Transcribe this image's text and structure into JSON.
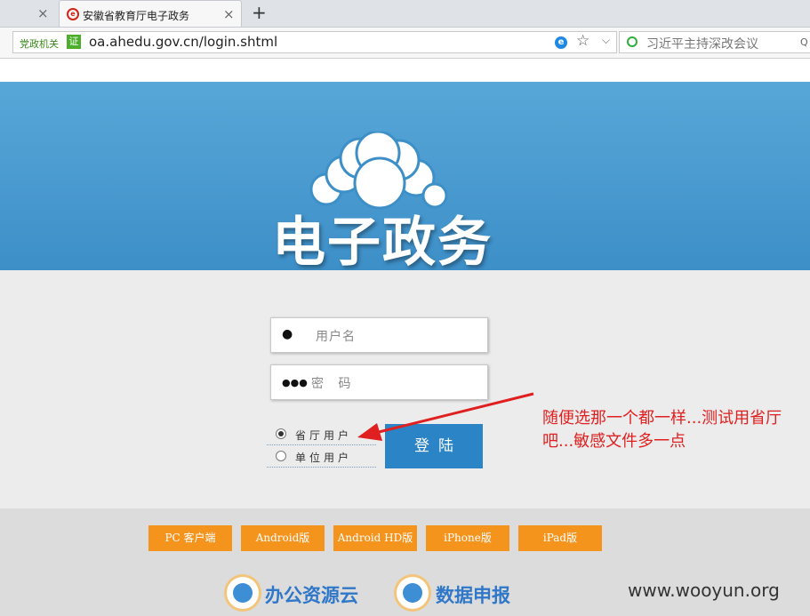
{
  "browser": {
    "tabs": [
      {
        "title": ""
      },
      {
        "title": "安徽省教育厅电子政务"
      }
    ],
    "close_glyph": "×",
    "new_tab_glyph": "+",
    "address": {
      "gov_label": "党政机关",
      "cert_badge": "证",
      "url": "oa.ahedu.gov.cn/login.shtml"
    },
    "search": {
      "text": "习近平主持深改会议"
    }
  },
  "banner": {
    "title": "电子政务",
    "logo_icon": "cloud-icon"
  },
  "login": {
    "username_placeholder": "用户名",
    "password_placeholder": "密 码",
    "user_types": [
      {
        "label": "省厅用户",
        "checked": true
      },
      {
        "label": "单位用户",
        "checked": false
      }
    ],
    "submit_label": "登陆"
  },
  "annotation": {
    "text": "随便选那一个都一样...测试用省厅吧...敏感文件多一点",
    "color": "#e02020"
  },
  "footer": {
    "downloads": [
      "PC 客户端",
      "Android版",
      "Android HD版",
      "iPhone版",
      "iPad版"
    ],
    "links": [
      "办公资源云",
      "数据申报"
    ],
    "watermark": "www.wooyun.org"
  },
  "colors": {
    "banner": "#4a9ad0",
    "button_blue": "#2b84c6",
    "download_orange": "#f5941d",
    "link_blue": "#2f77c8"
  }
}
